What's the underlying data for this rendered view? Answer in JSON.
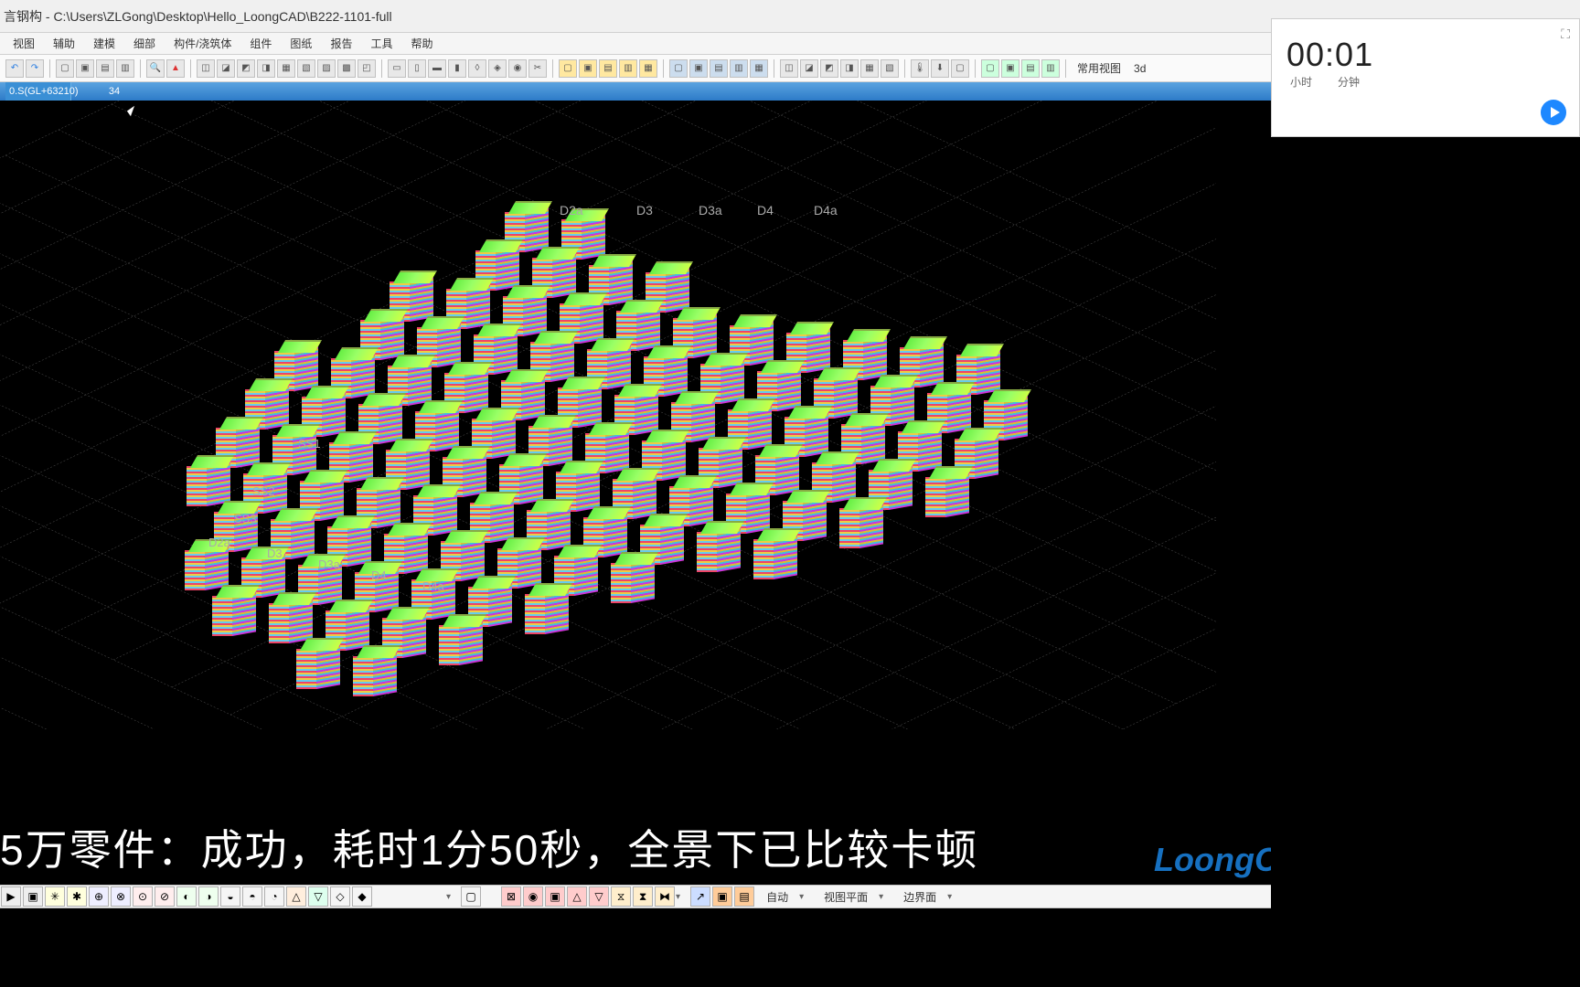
{
  "title": "言钢构 - C:\\Users\\ZLGong\\Desktop\\Hello_LoongCAD\\B222-1101-full",
  "menu": [
    "视图",
    "辅助",
    "建模",
    "细部",
    "构件/浇筑体",
    "组件",
    "图纸",
    "报告",
    "工具",
    "帮助"
  ],
  "status": {
    "left": "0.S(GL+63210)",
    "right": "34"
  },
  "view_dropdown": {
    "label": "常用视图",
    "value": "3d"
  },
  "grid_labels_top": [
    "D2a",
    "D3",
    "D3a",
    "D4",
    "D4a"
  ],
  "grid_labels_left": [
    "SS1",
    "SS2",
    "SS3",
    "D2a",
    "D3",
    "D3a",
    "D4",
    "D4a"
  ],
  "caption": "5万零件：成功，耗时1分50秒，全景下已比较卡顿",
  "watermark": "LoongCAD.c",
  "timer": {
    "value": "00:01",
    "hour_label": "小时",
    "min_label": "分钟"
  },
  "bottom": {
    "auto": "自动",
    "view_plane": "视图平面",
    "boundary": "边界面"
  }
}
